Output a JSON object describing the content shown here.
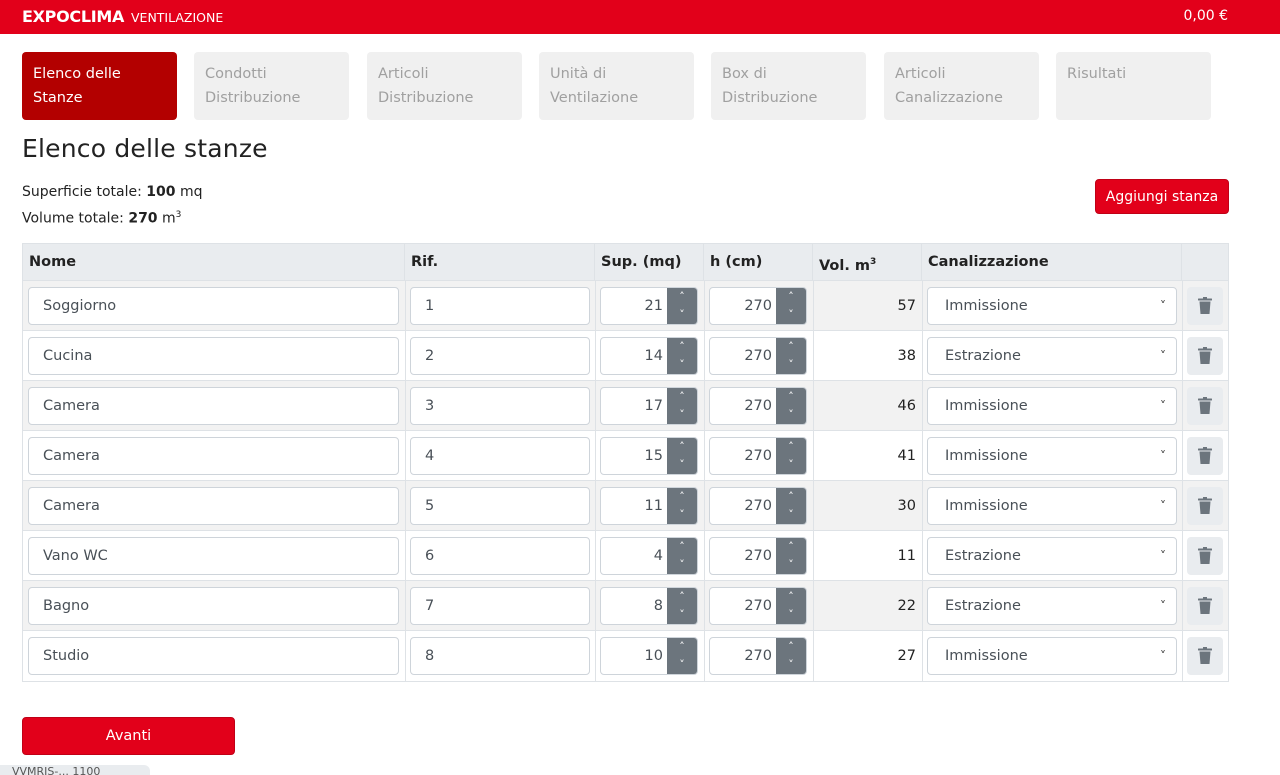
{
  "header": {
    "brand": "EXPOCLIMA",
    "subtitle": "VENTILAZIONE",
    "cart_total": "0,00 €",
    "bg_color": "#e2001a"
  },
  "steps": [
    {
      "label": "Elenco delle Stanze",
      "active": true
    },
    {
      "label": "Condotti Distribuzione",
      "active": false
    },
    {
      "label": "Articoli Distribuzione",
      "active": false
    },
    {
      "label": "Unità di Ventilazione",
      "active": false
    },
    {
      "label": "Box di Distribuzione",
      "active": false
    },
    {
      "label": "Articoli Canalizzazione",
      "active": false
    },
    {
      "label": "Risultati",
      "active": false
    }
  ],
  "page": {
    "title": "Elenco delle stanze",
    "surface_label": "Superficie totale:",
    "surface_value": "100",
    "surface_unit": "mq",
    "volume_label": "Volume totale:",
    "volume_value": "270",
    "volume_unit": "m",
    "volume_exp": "3",
    "add_button": "Aggiungi stanza",
    "next_button": "Avanti",
    "bottom_tag": "VVMRIS-... 1100"
  },
  "table": {
    "headers": {
      "nome": "Nome",
      "rif": "Rif.",
      "sup": "Sup. (mq)",
      "h": "h (cm)",
      "vol": "Vol. m",
      "vol_exp": "3",
      "canalizzazione": "Canalizzazione"
    },
    "rows": [
      {
        "nome": "Soggiorno",
        "rif": "1",
        "sup": "21",
        "h": "270",
        "vol": "57",
        "canalizzazione": "Immissione"
      },
      {
        "nome": "Cucina",
        "rif": "2",
        "sup": "14",
        "h": "270",
        "vol": "38",
        "canalizzazione": "Estrazione"
      },
      {
        "nome": "Camera",
        "rif": "3",
        "sup": "17",
        "h": "270",
        "vol": "46",
        "canalizzazione": "Immissione"
      },
      {
        "nome": "Camera",
        "rif": "4",
        "sup": "15",
        "h": "270",
        "vol": "41",
        "canalizzazione": "Immissione"
      },
      {
        "nome": "Camera",
        "rif": "5",
        "sup": "11",
        "h": "270",
        "vol": "30",
        "canalizzazione": "Immissione"
      },
      {
        "nome": "Vano WC",
        "rif": "6",
        "sup": "4",
        "h": "270",
        "vol": "11",
        "canalizzazione": "Estrazione"
      },
      {
        "nome": "Bagno",
        "rif": "7",
        "sup": "8",
        "h": "270",
        "vol": "22",
        "canalizzazione": "Estrazione"
      },
      {
        "nome": "Studio",
        "rif": "8",
        "sup": "10",
        "h": "270",
        "vol": "27",
        "canalizzazione": "Immissione"
      }
    ]
  },
  "icons": {
    "spin_up": "chevron-up-icon",
    "spin_down": "chevron-down-icon",
    "select": "chevron-down-icon",
    "delete": "trash-icon"
  }
}
